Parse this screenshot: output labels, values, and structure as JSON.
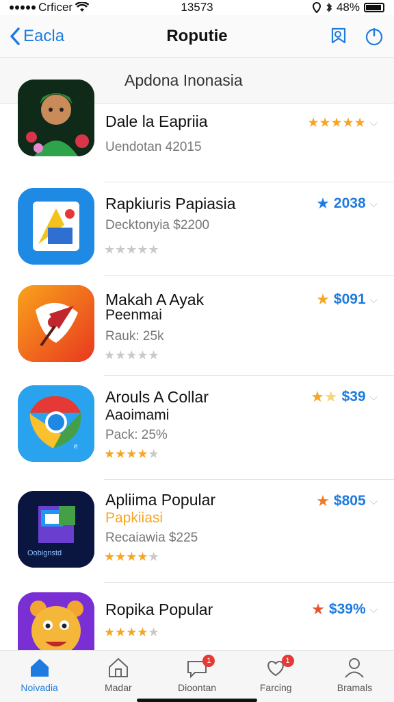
{
  "status_bar": {
    "carrier": "Crficer",
    "time": "13573",
    "battery": "48%"
  },
  "nav": {
    "back_label": "Eacla",
    "title": "Roputie"
  },
  "section": {
    "title": "Apdona Inonasia"
  },
  "apps": [
    {
      "name": "Dale la Eapriia",
      "subtitle": "",
      "meta": "Uendotan 42015",
      "price": "",
      "rating": 5,
      "rating_star_color": "#f5a623",
      "price_star": "",
      "show_row_stars": false
    },
    {
      "name": "Rapkiuris Papiasia",
      "subtitle": "",
      "meta": "Decktonyia $2200",
      "price": "2038",
      "rating": 0,
      "price_star_color": "#1e7be0",
      "show_row_stars": true
    },
    {
      "name": "Makah A Ayak",
      "subtitle": "Peenmai",
      "meta": "Rauk: 25k",
      "price": "$091",
      "rating": 0,
      "price_star_color": "#f5a623",
      "show_row_stars": true
    },
    {
      "name": "Arouls A Collar",
      "subtitle": "Aaoimami",
      "meta": "Pack: 25%",
      "price": "$39",
      "rating": 4,
      "price_star_color": "#f5a623",
      "show_row_stars": true
    },
    {
      "name": "Apliima Popular",
      "subtitle": "Papkiiasi",
      "meta": "Recaiawia $225",
      "price": "$805",
      "rating": 4,
      "price_star_color": "#f07a1e",
      "show_row_stars": true
    },
    {
      "name": "Ropika Popular",
      "subtitle": "",
      "meta": "",
      "price": "$39%",
      "rating": 4,
      "price_star_color": "#e8542a",
      "show_row_stars": true
    }
  ],
  "icon_names": [
    "boy-avatar-app-icon",
    "docs-app-icon",
    "bird-app-icon",
    "chrome-app-icon",
    "cube-app-icon",
    "lion-app-icon"
  ],
  "tabs": [
    {
      "label": "Noivadia",
      "icon": "home-icon",
      "active": true
    },
    {
      "label": "Madar",
      "icon": "store-icon",
      "active": false
    },
    {
      "label": "Dioontan",
      "icon": "chat-icon",
      "active": false,
      "badge": "1"
    },
    {
      "label": "Farcing",
      "icon": "heart-chat-icon",
      "active": false,
      "badge": "1"
    },
    {
      "label": "Bramals",
      "icon": "person-icon",
      "active": false
    }
  ],
  "colors": {
    "accent": "#1e7be0",
    "star": "#f5a623",
    "badge": "#e53935"
  }
}
